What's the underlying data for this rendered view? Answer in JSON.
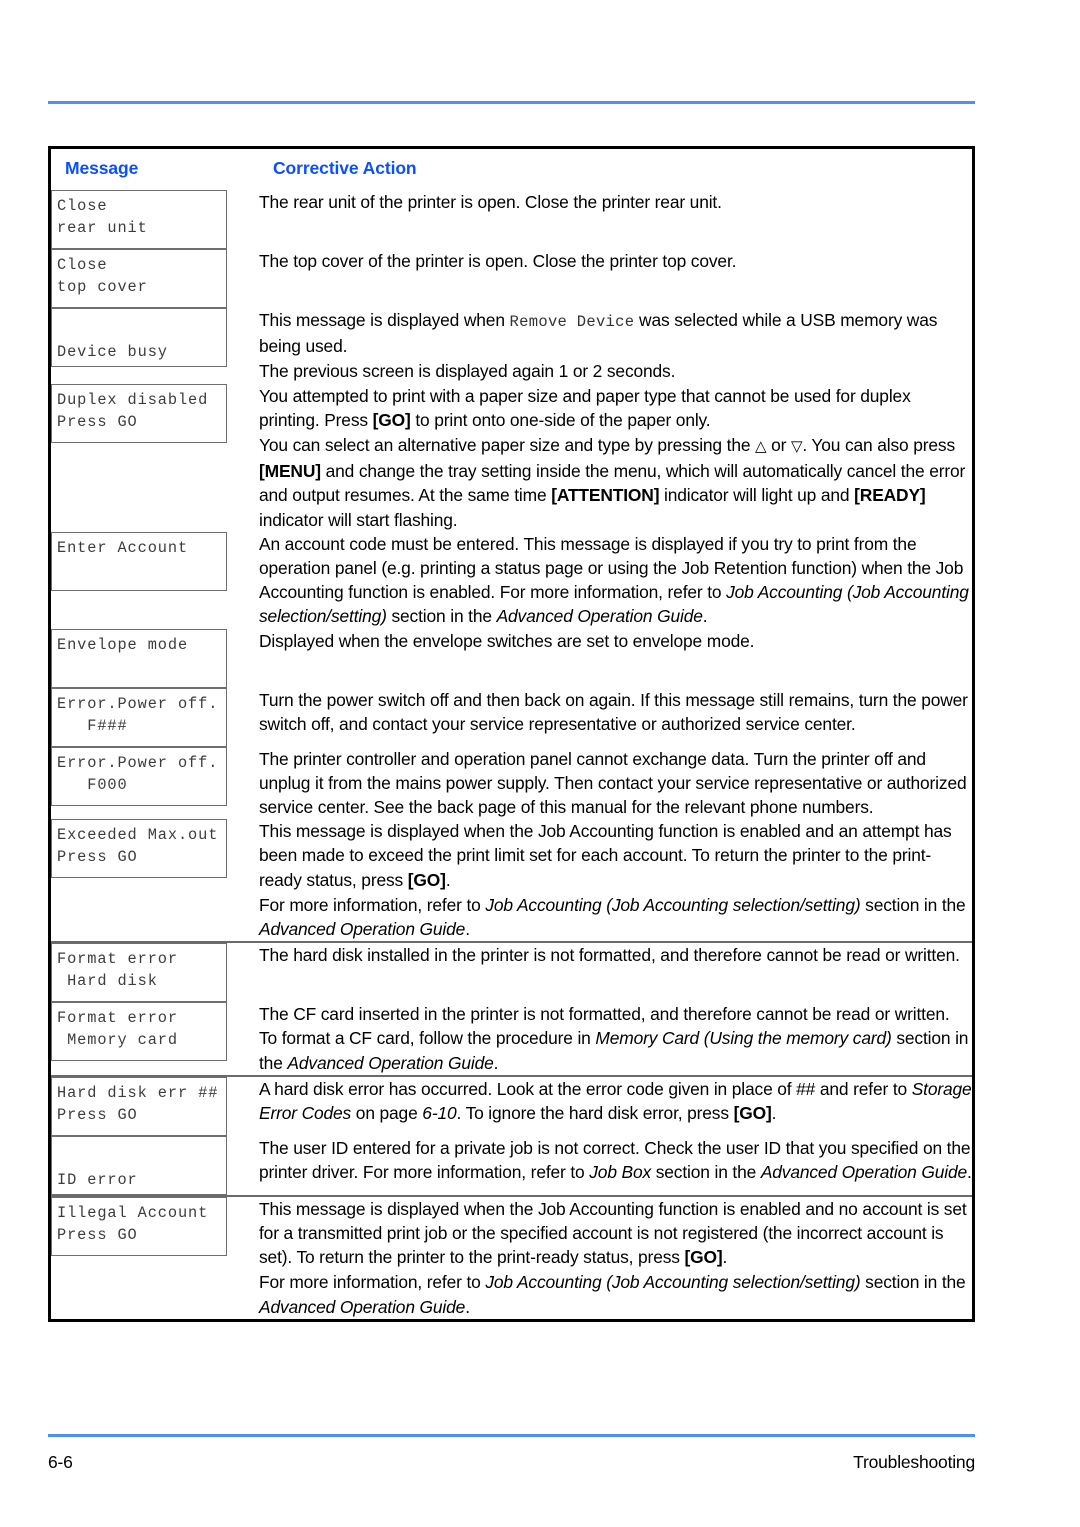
{
  "page": {
    "footer_page_number": "6-6",
    "footer_section": "Troubleshooting",
    "rule_color": "#4d8ef7",
    "header_text_color": "#0b4ffa"
  },
  "table": {
    "columns": [
      {
        "key": "message",
        "label": "Message"
      },
      {
        "key": "corrective_action",
        "label": "Corrective Action"
      }
    ],
    "rows": [
      {
        "id": "close-rear-unit",
        "lcd_lines": [
          "Close",
          "rear unit"
        ],
        "lcd_align": "top",
        "corrective_action": "The rear unit of the printer is open. Close the printer rear unit."
      },
      {
        "id": "close-top-cover",
        "lcd_lines": [
          "Close",
          "top cover"
        ],
        "lcd_align": "top",
        "corrective_action": "The top cover of the printer is open. Close the printer top cover."
      },
      {
        "id": "device-busy",
        "lcd_lines": [
          "",
          "Device busy"
        ],
        "lcd_align": "bottom",
        "corrective_action_p1_a": "This message is displayed when ",
        "corrective_action_p1_mono": "Remove Device",
        "corrective_action_p1_b": " was selected while a USB memory was being used.",
        "corrective_action_p2": "The previous screen is displayed again 1 or 2 seconds."
      },
      {
        "id": "duplex-disabled",
        "lcd_lines": [
          "Duplex disabled",
          "Press GO"
        ],
        "lcd_align": "top",
        "ca_seg_1": "You attempted to print with a paper size and paper type that cannot be used for duplex printing. Press ",
        "ca_seg_2": "[GO]",
        "ca_seg_3": " to print onto one-side of the paper only.",
        "ca_seg_4": "You can select an alternative paper size and type by pressing the ",
        "ca_seg_5": "△",
        "ca_seg_6": " or ",
        "ca_seg_7": "▽",
        "ca_seg_8": ". You can also press ",
        "ca_seg_9": "[MENU]",
        "ca_seg_10": " and change the tray setting inside the menu, which will automatically cancel the error and output resumes. At the same time ",
        "ca_seg_11": "[ATTENTION]",
        "ca_seg_12": " indicator will light up and ",
        "ca_seg_13": "[READY]",
        "ca_seg_14": " indicator will start flashing."
      },
      {
        "id": "enter-account",
        "lcd_lines": [
          "Enter Account",
          ""
        ],
        "lcd_align": "top",
        "ca_seg_1": "An account code must be entered. This message is displayed if you try to print from the operation panel (e.g. printing a status page or using the Job Retention function) when the Job Accounting function is enabled. For more information, refer to ",
        "ca_seg_2": "Job Accounting (Job Accounting selection/setting)",
        "ca_seg_3": " section in the ",
        "ca_seg_4": "Advanced Operation Guide",
        "ca_seg_5": "."
      },
      {
        "id": "envelope-mode",
        "lcd_lines": [
          "Envelope mode",
          ""
        ],
        "lcd_align": "top",
        "corrective_action": "Displayed when the envelope switches are set to envelope mode."
      },
      {
        "id": "error-power-off-fhash",
        "lcd_lines": [
          "Error.Power off.",
          "   F###"
        ],
        "lcd_align": "top",
        "corrective_action": "Turn the power switch off and then back on again. If this message still remains, turn the power switch off, and contact your service representative or authorized service center."
      },
      {
        "id": "error-power-off-f000",
        "lcd_lines": [
          "Error.Power off.",
          "   F000"
        ],
        "lcd_align": "top",
        "corrective_action": "The printer controller and operation panel cannot exchange data. Turn the printer off and unplug it from the mains power supply. Then contact your service representative or authorized service center. See the back page of this manual for the relevant phone numbers."
      },
      {
        "id": "exceeded-max-out",
        "lcd_lines": [
          "Exceeded Max.out",
          "Press GO"
        ],
        "lcd_align": "top",
        "ca_seg_1": "This message is displayed when the Job Accounting function is enabled and an attempt has been made to exceed the print limit set for each account. To return the printer to the print-ready status, press ",
        "ca_seg_2": "[GO]",
        "ca_seg_3": ".",
        "ca_seg_4": "For more information, refer to ",
        "ca_seg_5": "Job Accounting (Job Accounting selection/setting)",
        "ca_seg_6": " section in the ",
        "ca_seg_7": "Advanced Operation Guide",
        "ca_seg_8": "."
      },
      {
        "id": "format-error-hard-disk",
        "lcd_lines": [
          "Format error",
          " Hard disk"
        ],
        "lcd_align": "top",
        "corrective_action": "The hard disk installed in the printer is not formatted, and therefore cannot be read or written."
      },
      {
        "id": "format-error-memory-card",
        "lcd_lines": [
          "Format error",
          " Memory card"
        ],
        "lcd_align": "top",
        "ca_seg_1": "The CF card inserted in the printer is not formatted, and therefore cannot be read or written. To format a CF card, follow the procedure in ",
        "ca_seg_2": "Memory Card (Using the memory card)",
        "ca_seg_3": " section in the ",
        "ca_seg_4": "Advanced Operation Guide",
        "ca_seg_5": "."
      },
      {
        "id": "hard-disk-err",
        "lcd_lines": [
          "Hard disk err ##",
          "Press GO"
        ],
        "lcd_align": "top",
        "ca_seg_1": "A hard disk error has occurred. Look at the error code given in place of ## and refer to ",
        "ca_seg_2": "Storage Error Codes",
        "ca_seg_3": " on page ",
        "ca_seg_4": "6-10",
        "ca_seg_5": ". To ignore the hard disk error, press ",
        "ca_seg_6": "[GO]",
        "ca_seg_7": "."
      },
      {
        "id": "id-error",
        "lcd_lines": [
          "",
          "ID error"
        ],
        "lcd_align": "bottom",
        "ca_seg_1": "The user ID entered for a private job is not correct. Check the user ID that you specified on the printer driver. For more information, refer to ",
        "ca_seg_2": "Job Box",
        "ca_seg_3": " section in the ",
        "ca_seg_4": "Advanced Operation Guide",
        "ca_seg_5": "."
      },
      {
        "id": "illegal-account",
        "lcd_lines": [
          "Illegal Account",
          "Press GO"
        ],
        "lcd_align": "top",
        "ca_seg_1": "This message is displayed when the Job Accounting function is enabled and no account is set for a transmitted print job or the specified account is not registered (the incorrect account is set). To return the printer to the print-ready status, press ",
        "ca_seg_2": "[GO]",
        "ca_seg_3": ".",
        "ca_seg_4": "For more information, refer to ",
        "ca_seg_5": "Job Accounting (Job Accounting selection/setting)",
        "ca_seg_6": " section in the ",
        "ca_seg_7": "Advanced Operation Guide",
        "ca_seg_8": "."
      }
    ]
  }
}
